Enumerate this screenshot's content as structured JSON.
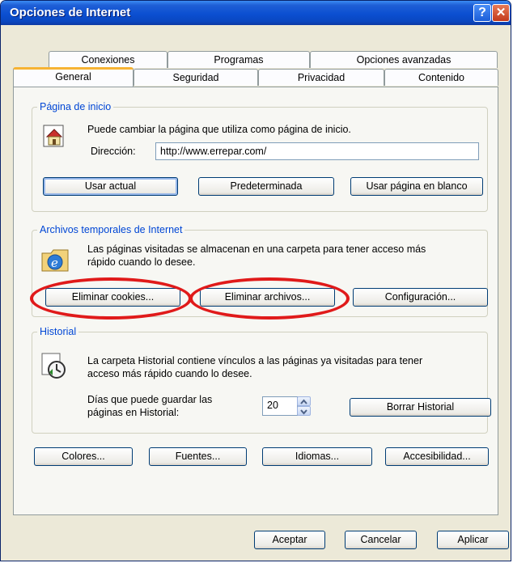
{
  "window": {
    "title": "Opciones de Internet",
    "help_glyph": "?",
    "close_glyph": "✕"
  },
  "tabs_row_back": [
    "Conexiones",
    "Programas",
    "Opciones avanzadas"
  ],
  "tabs_row_front": [
    "General",
    "Seguridad",
    "Privacidad",
    "Contenido"
  ],
  "active_tab": "General",
  "home_page": {
    "group_label": "Página de inicio",
    "description": "Puede cambiar la página que utiliza como página de inicio.",
    "address_label": "Dirección:",
    "address_value": "http://www.errepar.com/",
    "btn_use_current": "Usar actual",
    "btn_default": "Predeterminada",
    "btn_blank": "Usar página en blanco",
    "icon": "home-page-icon"
  },
  "temp_files": {
    "group_label": "Archivos temporales de Internet",
    "description_line1": "Las páginas visitadas se almacenan en una carpeta para tener acceso más",
    "description_line2": "rápido cuando lo desee.",
    "btn_delete_cookies": "Eliminar cookies...",
    "btn_delete_files": "Eliminar archivos...",
    "btn_settings": "Configuración...",
    "icon": "ie-folder-icon"
  },
  "history": {
    "group_label": "Historial",
    "description_line1": "La carpeta Historial contiene vínculos a las páginas ya visitadas para tener",
    "description_line2": "acceso más rápido cuando lo desee.",
    "days_label_line1": "Días que puede guardar las",
    "days_label_line2": "páginas en Historial:",
    "days_value": "20",
    "btn_clear": "Borrar Historial",
    "icon": "history-clock-icon"
  },
  "bottom_buttons": {
    "colors": "Colores...",
    "fonts": "Fuentes...",
    "languages": "Idiomas...",
    "accessibility": "Accesibilidad..."
  },
  "dialog_buttons": {
    "ok": "Aceptar",
    "cancel": "Cancelar",
    "apply": "Aplicar"
  },
  "colors": {
    "titlebar": "#0b4fd1",
    "face": "#ece9d8",
    "group_label": "#0046d5",
    "highlight_oval": "#e01a1a"
  }
}
